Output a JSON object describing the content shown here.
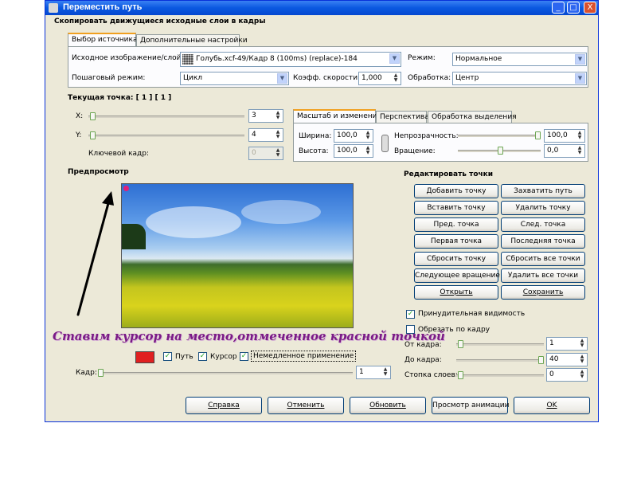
{
  "window": {
    "title": "Переместить путь",
    "subtitle": "Скопировать движущиеся исходные слои в кадры",
    "controls": {
      "minimize": "_",
      "maximize": "□",
      "close": "X"
    }
  },
  "top_tabs": [
    "Выбор источника",
    "Дополнительные настройки"
  ],
  "source": {
    "image_label": "Исходное изображение/слой:",
    "image_value": "Голубь.xcf-49/Кадр 8 (100ms) (replace)-184",
    "mode_label": "Режим:",
    "mode_value": "Нормальное",
    "step_label": "Пошаговый режим:",
    "step_value": "Цикл",
    "speed_label": "Коэфф. скорости:",
    "speed_value": "1,000",
    "handling_label": "Обработка:",
    "handling_value": "Центр"
  },
  "current_point": {
    "label": "Текущая точка: [  1 ]  [  1 ]",
    "x_label": "X:",
    "x_value": "3",
    "y_label": "Y:",
    "y_value": "4",
    "keyframe_label": "Ключевой кадр:",
    "keyframe_value": "0"
  },
  "transform_tabs": [
    "Масштаб и изменение",
    "Перспектива",
    "Обработка выделения"
  ],
  "transform": {
    "width_label": "Ширина:",
    "width_value": "100,0",
    "height_label": "Высота:",
    "height_value": "100,0",
    "opacity_label": "Непрозрачность:",
    "opacity_value": "100,0",
    "rotation_label": "Вращение:",
    "rotation_value": "0,0"
  },
  "preview": {
    "label": "Предпросмотр",
    "annotation": "Ставим курсор на место,отмеченное красной точкой",
    "path_label": "Путь",
    "cursor_label": "Курсор",
    "instant_label": "Немедленное применение",
    "frame_label": "Кадр:",
    "frame_value": "1",
    "marker_color": "#e02020"
  },
  "edit_points": {
    "label": "Редактировать точки",
    "buttons": [
      [
        "Добавить точку",
        "Захватить путь"
      ],
      [
        "Вставить точку",
        "Удалить точку"
      ],
      [
        "Пред. точка",
        "След. точка"
      ],
      [
        "Первая точка",
        "Последняя точка"
      ],
      [
        "Сбросить точку",
        "Сбросить все точки"
      ],
      [
        "Следующее вращение",
        "Удалить все точки"
      ],
      [
        "Открыть",
        "Сохранить"
      ]
    ]
  },
  "options": {
    "force_visibility": "Принудительная видимость",
    "clip_to_frame": "Обрезать по кадру",
    "from_frame_label": "От кадра:",
    "from_frame_value": "1",
    "to_frame_label": "До кадра:",
    "to_frame_value": "40",
    "layer_stack_label": "Стопка слоев:",
    "layer_stack_value": "0"
  },
  "footer_buttons": [
    "Справка",
    "Отменить",
    "Обновить",
    "Просмотр анимации",
    "OK"
  ],
  "colors": {
    "accent": "#0a58e0",
    "title_bar": "#0548d0",
    "dialog_bg": "#ece9d8"
  }
}
